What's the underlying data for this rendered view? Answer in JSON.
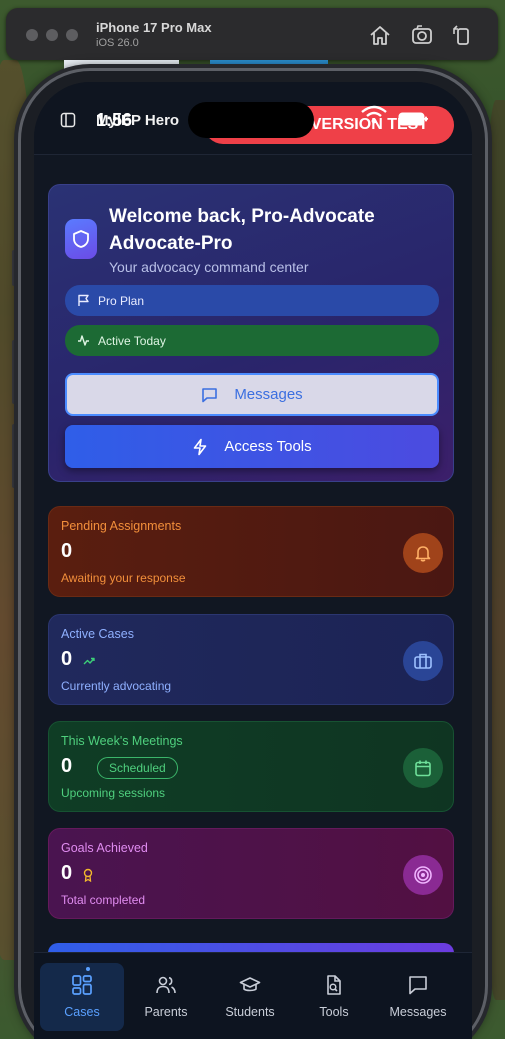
{
  "simulator": {
    "device_name": "iPhone 17 Pro Max",
    "os_version": "iOS 26.0"
  },
  "status_bar": {
    "time": "1:56"
  },
  "header": {
    "app_title": "MyIEP Hero",
    "version_banner": "P VERSION TEST"
  },
  "welcome": {
    "title": "Welcome back, Pro-Advocate Advocate-Pro",
    "subtitle": "Your advocacy command center",
    "plan_label": "Pro Plan",
    "activity_label": "Active Today",
    "messages_button": "Messages",
    "tools_button": "Access Tools"
  },
  "stats": [
    {
      "label": "Pending Assignments",
      "value": "0",
      "sub": "Awaiting your response",
      "icon": "bell-icon"
    },
    {
      "label": "Active Cases",
      "value": "0",
      "sub": "Currently advocating",
      "icon": "briefcase-icon"
    },
    {
      "label": "This Week's Meetings",
      "value": "0",
      "badge": "Scheduled",
      "sub": "Upcoming sessions",
      "icon": "calendar-icon"
    },
    {
      "label": "Goals Achieved",
      "value": "0",
      "sub": "Total completed",
      "icon": "target-icon"
    }
  ],
  "nav": {
    "items": [
      {
        "label": "Cases",
        "icon": "grid-icon",
        "active": true
      },
      {
        "label": "Parents",
        "icon": "users-icon"
      },
      {
        "label": "Students",
        "icon": "graduation-cap-icon"
      },
      {
        "label": "Tools",
        "icon": "file-search-icon"
      },
      {
        "label": "Messages",
        "icon": "message-icon"
      }
    ]
  },
  "colors": {
    "accent": "#4b8cff",
    "danger": "#ef4048",
    "screen_bg": "#111722"
  }
}
